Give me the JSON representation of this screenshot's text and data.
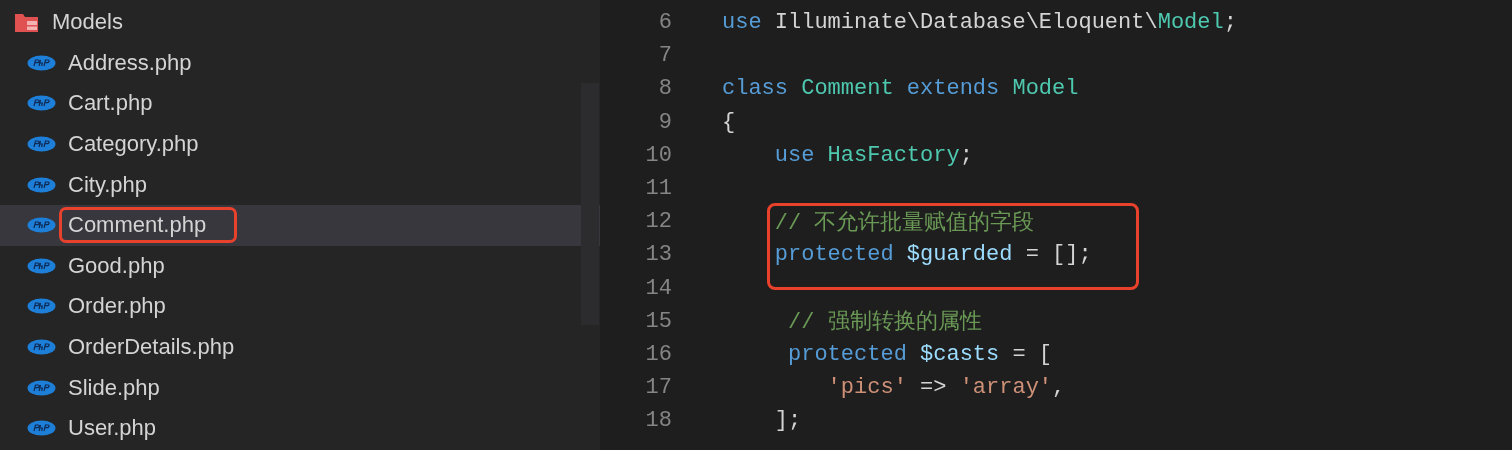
{
  "sidebar": {
    "folder": {
      "label": "Models",
      "children": [
        {
          "label": "Address.php",
          "selected": false,
          "annotated": false
        },
        {
          "label": "Cart.php",
          "selected": false,
          "annotated": false
        },
        {
          "label": "Category.php",
          "selected": false,
          "annotated": false
        },
        {
          "label": "City.php",
          "selected": false,
          "annotated": false
        },
        {
          "label": "Comment.php",
          "selected": true,
          "annotated": true
        },
        {
          "label": "Good.php",
          "selected": false,
          "annotated": false
        },
        {
          "label": "Order.php",
          "selected": false,
          "annotated": false
        },
        {
          "label": "OrderDetails.php",
          "selected": false,
          "annotated": false
        },
        {
          "label": "Slide.php",
          "selected": false,
          "annotated": false
        },
        {
          "label": "User.php",
          "selected": false,
          "annotated": false
        }
      ]
    }
  },
  "editor": {
    "lines": [
      {
        "number": "6",
        "annotated": false,
        "tokens": [
          {
            "kind": "keyword",
            "text": "use"
          },
          {
            "kind": "plain",
            "text": " Illuminate\\Database\\Eloquent\\"
          },
          {
            "kind": "type",
            "text": "Model"
          },
          {
            "kind": "plain",
            "text": ";"
          }
        ]
      },
      {
        "number": "7",
        "annotated": false
      },
      {
        "number": "8",
        "annotated": false,
        "tokens": [
          {
            "kind": "keyword",
            "text": "class"
          },
          {
            "kind": "type",
            "text": " Comment"
          },
          {
            "kind": "keyword",
            "text": " extends"
          },
          {
            "kind": "type",
            "text": " Model"
          }
        ]
      },
      {
        "number": "9",
        "annotated": false,
        "tokens": [
          {
            "kind": "plain",
            "text": "{"
          }
        ]
      },
      {
        "number": "10",
        "annotated": false,
        "tokens": [
          {
            "kind": "keyword",
            "text": "    use"
          },
          {
            "kind": "type",
            "text": " HasFactory"
          },
          {
            "kind": "plain",
            "text": ";"
          }
        ]
      },
      {
        "number": "11",
        "annotated": false
      },
      {
        "number": "12",
        "annotated": true,
        "tokens": [
          {
            "kind": "comment",
            "text": "    // 不允许批量赋值的字段"
          }
        ]
      },
      {
        "number": "13",
        "annotated": true,
        "tokens": [
          {
            "kind": "keyword",
            "text": "    protected"
          },
          {
            "kind": "variable",
            "text": " $guarded"
          },
          {
            "kind": "plain",
            "text": " = [];"
          }
        ]
      },
      {
        "number": "14",
        "annotated": false
      },
      {
        "number": "15",
        "annotated": false,
        "tokens": [
          {
            "kind": "comment",
            "text": "     // 强制转换的属性"
          }
        ]
      },
      {
        "number": "16",
        "annotated": false,
        "tokens": [
          {
            "kind": "keyword",
            "text": "     protected"
          },
          {
            "kind": "variable",
            "text": " $casts"
          },
          {
            "kind": "plain",
            "text": " = ["
          }
        ]
      },
      {
        "number": "17",
        "annotated": false,
        "tokens": [
          {
            "kind": "string",
            "text": "        'pics'"
          },
          {
            "kind": "plain",
            "text": " => "
          },
          {
            "kind": "string",
            "text": "'array'"
          },
          {
            "kind": "plain",
            "text": ","
          }
        ]
      },
      {
        "number": "18",
        "annotated": false,
        "tokens": [
          {
            "kind": "plain",
            "text": "    ];"
          }
        ]
      }
    ]
  }
}
